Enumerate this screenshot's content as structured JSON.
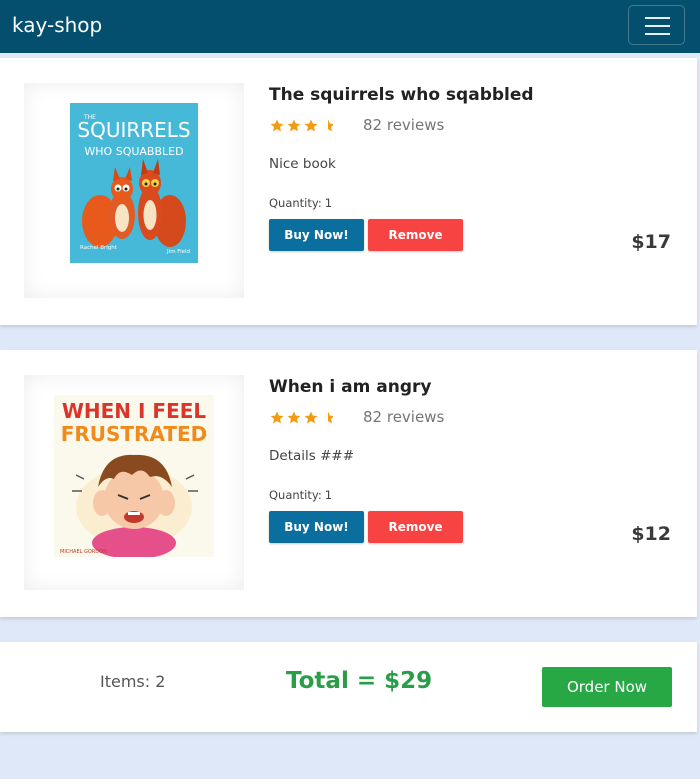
{
  "navbar": {
    "brand": "kay-shop",
    "color": "#044e6e"
  },
  "products": [
    {
      "title": "The squirrels who sqabbled",
      "rating": 3.5,
      "reviews": "82 reviews",
      "details": "Nice book",
      "quantity_label": "Quantity:",
      "quantity": "1",
      "buy_label": "Buy Now!",
      "remove_label": "Remove",
      "price": "$17",
      "cover": {
        "title_small": "THE",
        "title_big": "SQUIRRELS",
        "title_rest": "WHO SQUABBLED",
        "author_left": "Rachel Bright",
        "author_right": "Jim Field"
      }
    },
    {
      "title": "When i am angry",
      "rating": 3.5,
      "reviews": "82 reviews",
      "details": "Details ###",
      "quantity_label": "Quantity:",
      "quantity": "1",
      "buy_label": "Buy Now!",
      "remove_label": "Remove",
      "price": "$12",
      "cover": {
        "line1": "WHEN I FEEL",
        "line2": "FRUSTRATED",
        "author": "MICHAEL GORDON"
      }
    }
  ],
  "summary": {
    "items": "Items: 2",
    "total": "Total = $29",
    "order_label": "Order Now"
  },
  "colors": {
    "buy": "#0a6f9e",
    "remove": "#f84343",
    "order": "#28a745",
    "total": "#2a9d48",
    "star": "#f39c12"
  }
}
